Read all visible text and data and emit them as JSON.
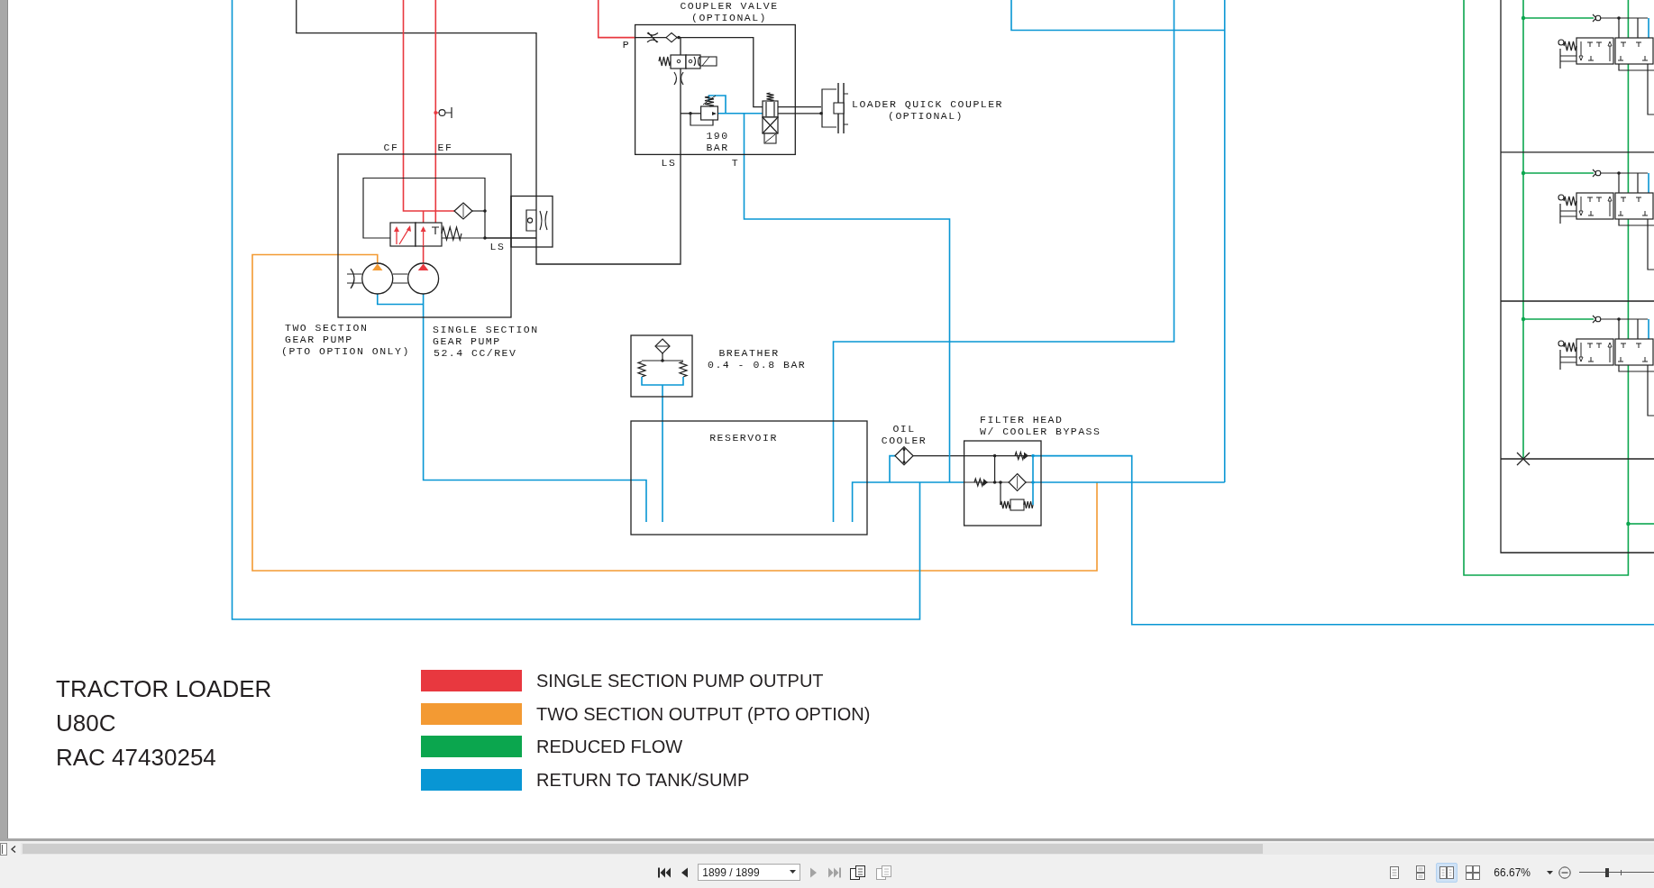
{
  "diagram": {
    "labels": [
      "COUPLER VALVE",
      "(OPTIONAL)",
      "P",
      "190",
      "BAR",
      "LS",
      "T",
      "LOADER QUICK COUPLER",
      "(OPTIONAL)",
      "CF",
      "EF",
      "LS",
      "TWO SECTION",
      "GEAR PUMP",
      "(PTO OPTION ONLY)",
      "SINGLE SECTION",
      "GEAR PUMP",
      "52.4 CC/REV",
      "BREATHER",
      "0.4 - 0.8 BAR",
      "RESERVOIR",
      "OIL",
      "COOLER",
      "FILTER HEAD",
      "W/ COOLER BYPASS"
    ]
  },
  "title_block": [
    "TRACTOR LOADER",
    "U80C",
    "RAC 47430254"
  ],
  "legend": [
    {
      "label": "SINGLE SECTION PUMP OUTPUT",
      "color": "#e8383f"
    },
    {
      "label": "TWO SECTION OUTPUT (PTO OPTION)",
      "color": "#f39a33"
    },
    {
      "label": "REDUCED FLOW",
      "color": "#0ba64e"
    },
    {
      "label": "RETURN TO TANK/SUMP",
      "color": "#0896d4"
    }
  ],
  "toolbar": {
    "nav_left": [
      {
        "kind": "first",
        "disabled": false
      },
      {
        "kind": "previous",
        "disabled": false
      }
    ],
    "page_field": {
      "value": "1899 / 1899"
    },
    "nav_right": [
      {
        "kind": "next",
        "disabled": true
      },
      {
        "kind": "last",
        "disabled": true
      },
      {
        "kind": "pages",
        "disabled": false
      },
      {
        "kind": "pages",
        "disabled": true
      }
    ],
    "view_buttons": [
      {
        "kind": "single",
        "selected": false
      },
      {
        "kind": "continuous",
        "selected": false
      },
      {
        "kind": "facing",
        "selected": true
      },
      {
        "kind": "facing_continuous",
        "selected": false
      }
    ],
    "zoom": {
      "value": "66.67%"
    },
    "zoom_slider": {
      "level": 0.35
    }
  }
}
